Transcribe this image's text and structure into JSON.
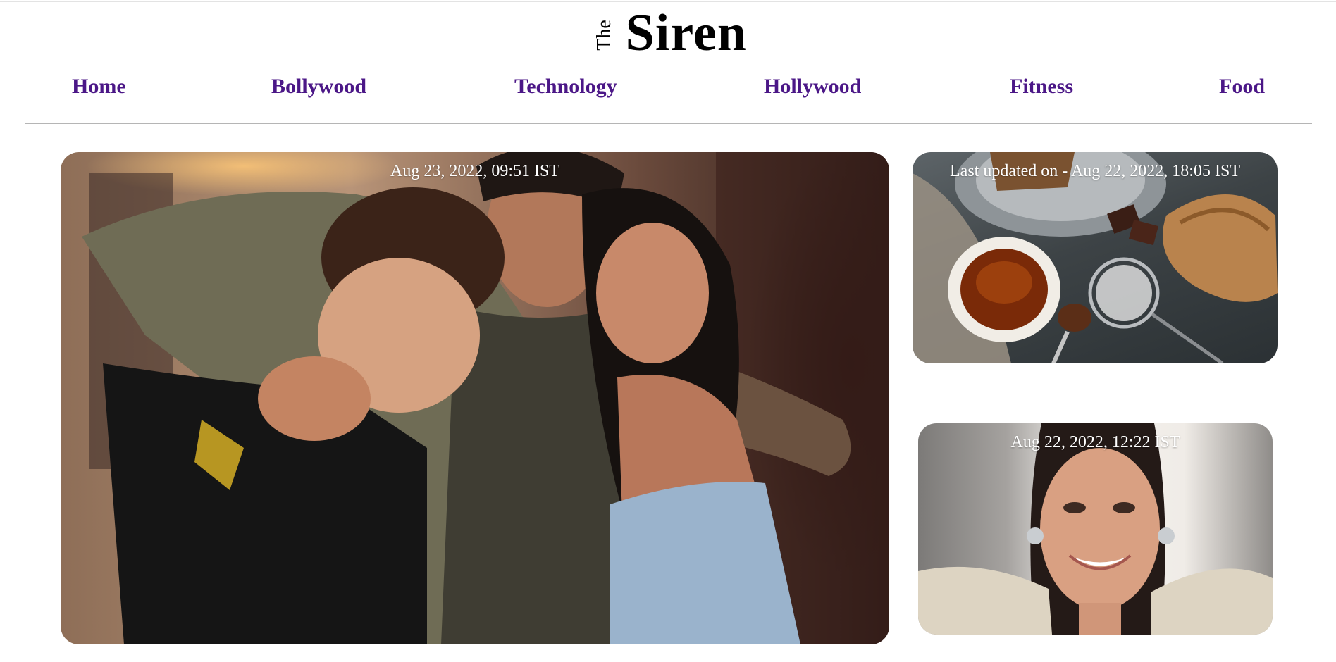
{
  "site": {
    "logo_prefix": "The",
    "logo_name": "Siren"
  },
  "nav": {
    "items": [
      {
        "label": "Home"
      },
      {
        "label": "Bollywood"
      },
      {
        "label": "Technology"
      },
      {
        "label": "Hollywood"
      },
      {
        "label": "Fitness"
      },
      {
        "label": "Food"
      }
    ]
  },
  "articles": {
    "main": {
      "date": "Aug 23, 2022, 09:51 IST"
    },
    "food": {
      "date": "Last updated on - Aug 22, 2022, 18:05 IST"
    },
    "portrait": {
      "date": "Aug 22, 2022, 12:22 IST"
    }
  },
  "colors": {
    "nav_link": "#4b1787",
    "logo": "#000000",
    "divider": "#b5b5b5",
    "date_text": "#ffffff"
  }
}
